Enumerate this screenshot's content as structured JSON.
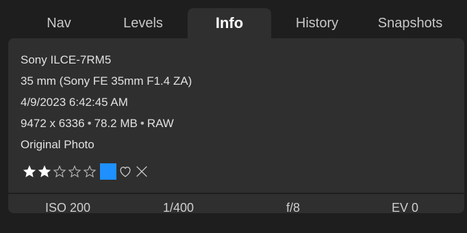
{
  "tabs": [
    {
      "label": "Nav",
      "active": false
    },
    {
      "label": "Levels",
      "active": false
    },
    {
      "label": "Info",
      "active": true
    },
    {
      "label": "History",
      "active": false
    },
    {
      "label": "Snapshots",
      "active": false
    }
  ],
  "info": {
    "camera": "Sony ILCE-7RM5",
    "lens": "35 mm (Sony FE 35mm F1.4 ZA)",
    "datetime": "4/9/2023 6:42:45 AM",
    "dimensions": "9472 x 6336",
    "file_size": "78.2 MB",
    "format": "RAW",
    "separator": "•",
    "photo_state": "Original Photo"
  },
  "rating": {
    "stars_filled": 2,
    "stars_total": 5,
    "color_label": "#1e90ff",
    "icons": [
      "star-filled-icon",
      "star-outline-icon",
      "color-label-swatch",
      "heart-outline-icon",
      "reject-x-icon"
    ]
  },
  "exposure": {
    "iso": "ISO 200",
    "shutter": "1/400",
    "aperture": "f/8",
    "ev": "EV 0"
  },
  "colors": {
    "background": "#1e1e1e",
    "panel": "#2f2f2f",
    "accent": "#1e90ff"
  }
}
